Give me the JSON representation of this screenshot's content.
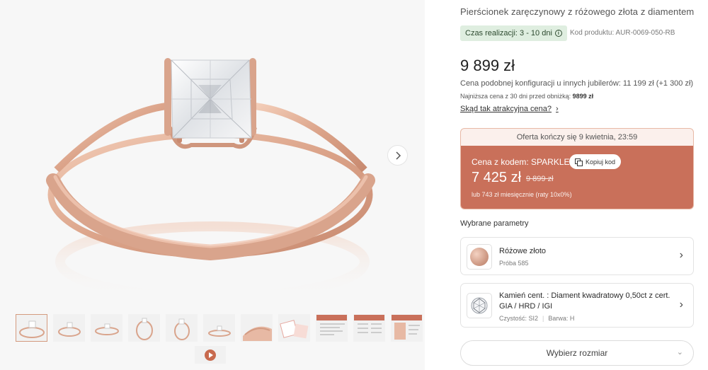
{
  "product": {
    "title": "Pierścionek zaręczynowy z różowego złota z diamentem",
    "lead_time": "Czas realizacji: 3 - 10 dni",
    "product_code": "Kod produktu: AUR-0069-050-RB",
    "price": "9 899 zł",
    "compare_price": "Cena podobnej konfiguracji u innych jubilerów: 11 199 zł (+1 300 zł)",
    "lowest_price_label": "Najniższa cena z 30 dni przed obniżką:",
    "lowest_price_value": "9899 zł",
    "why_link": "Skąd tak atrakcyjna cena?"
  },
  "promo": {
    "offer_end": "Oferta kończy się 9 kwietnia, 23:59",
    "code_label": "Cena z kodem: SPARKLE",
    "copy_button": "Kopiuj kod",
    "promo_price": "7 425 zł",
    "old_price": "9 899 zł",
    "installment": "lub 743 zł miesięcznie (raty 10x0%)"
  },
  "params": {
    "heading": "Wybrane parametry",
    "metal": {
      "name": "Różowe złoto",
      "sub": "Próba 585"
    },
    "stone": {
      "name": "Kamień cent. : Diament kwadratowy 0,50ct z cert. GIA / HRD / IGI",
      "clarity": "Czystość: SI2",
      "color": "Barwa: H"
    }
  },
  "size_select": {
    "label": "Wybierz rozmiar"
  },
  "gallery": {
    "thumbnails": [
      "ring-front",
      "ring-side-1",
      "ring-angle",
      "ring-top",
      "ring-side-2",
      "ring-flat",
      "hand-model",
      "packaging",
      "certificate-1",
      "certificate-2",
      "certificate-3"
    ],
    "active_index": 0,
    "video_thumbnail": "video-play"
  },
  "colors": {
    "accent": "#c9705a",
    "lead_badge_bg": "#dfeee0",
    "rose_gold": "#d9a48c"
  }
}
